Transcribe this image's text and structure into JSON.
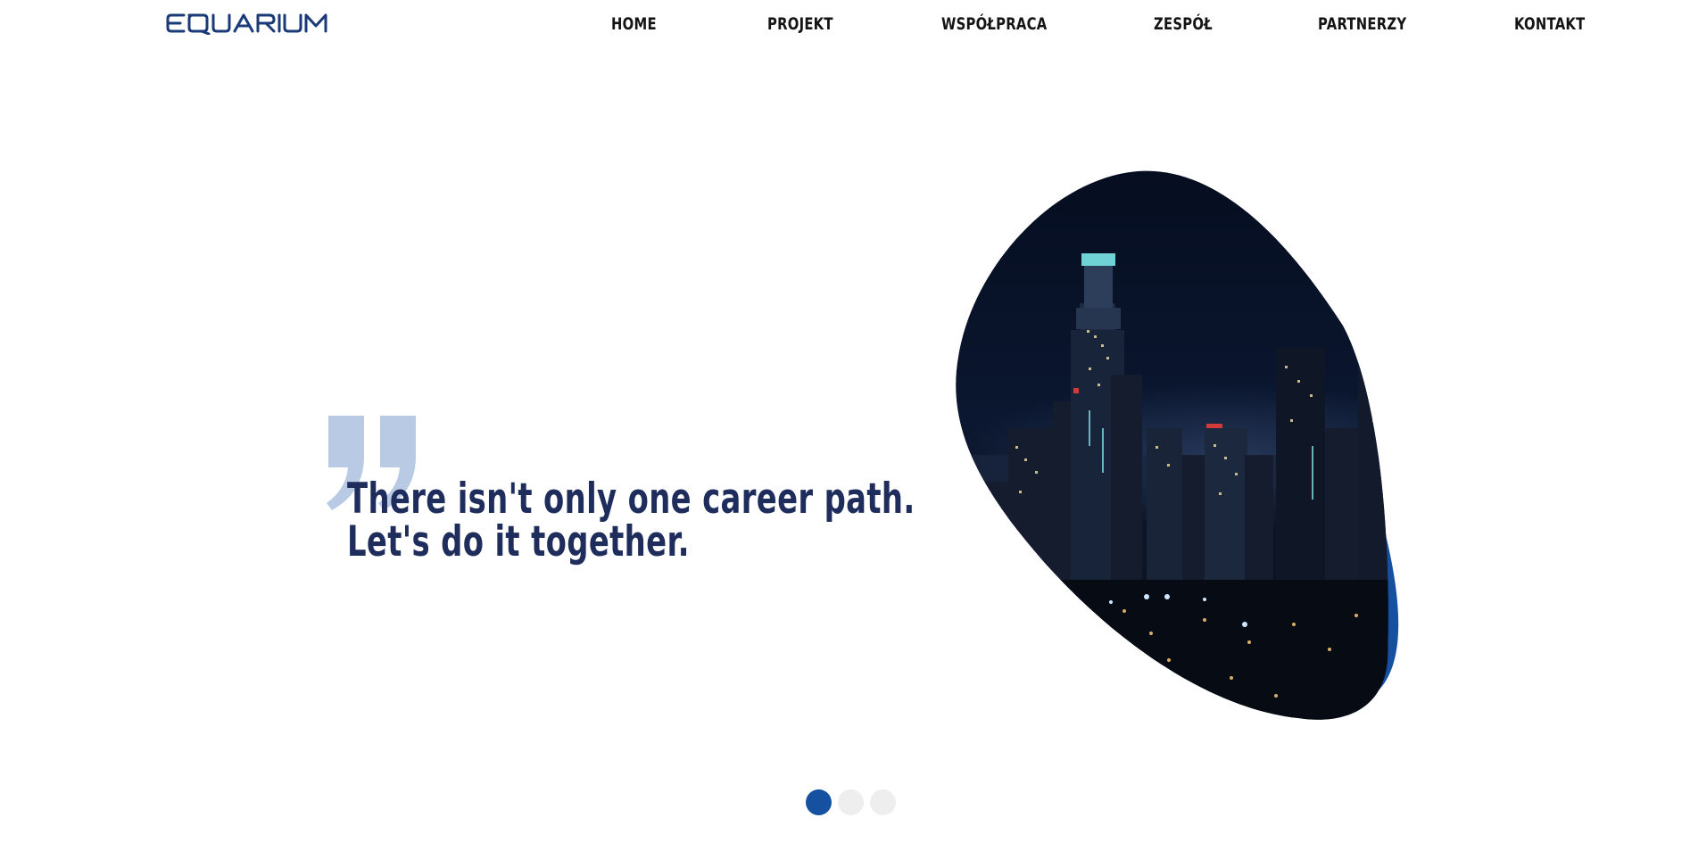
{
  "brand": {
    "logo_text": "EQUARIUM",
    "logo_color": "#1a3a78"
  },
  "nav": {
    "items": [
      {
        "label": "HOME"
      },
      {
        "label": "PROJEKT"
      },
      {
        "label": "WSPÓŁPRACA"
      },
      {
        "label": "ZESPÓŁ"
      },
      {
        "label": "PARTNERZY"
      },
      {
        "label": "KONTAKT"
      }
    ]
  },
  "hero": {
    "headline_line1": "There isn't only one career path.",
    "headline_line2": "Let's do it together.",
    "headline_color": "#1f2d5c",
    "quote_color": "#b8cae4",
    "accent_color": "#1650a0",
    "image_icon": "city-night-skyline-image"
  },
  "slider": {
    "total_slides": 3,
    "active_slide": 1,
    "active_color": "#1650a0",
    "inactive_color": "#eeeeee"
  }
}
